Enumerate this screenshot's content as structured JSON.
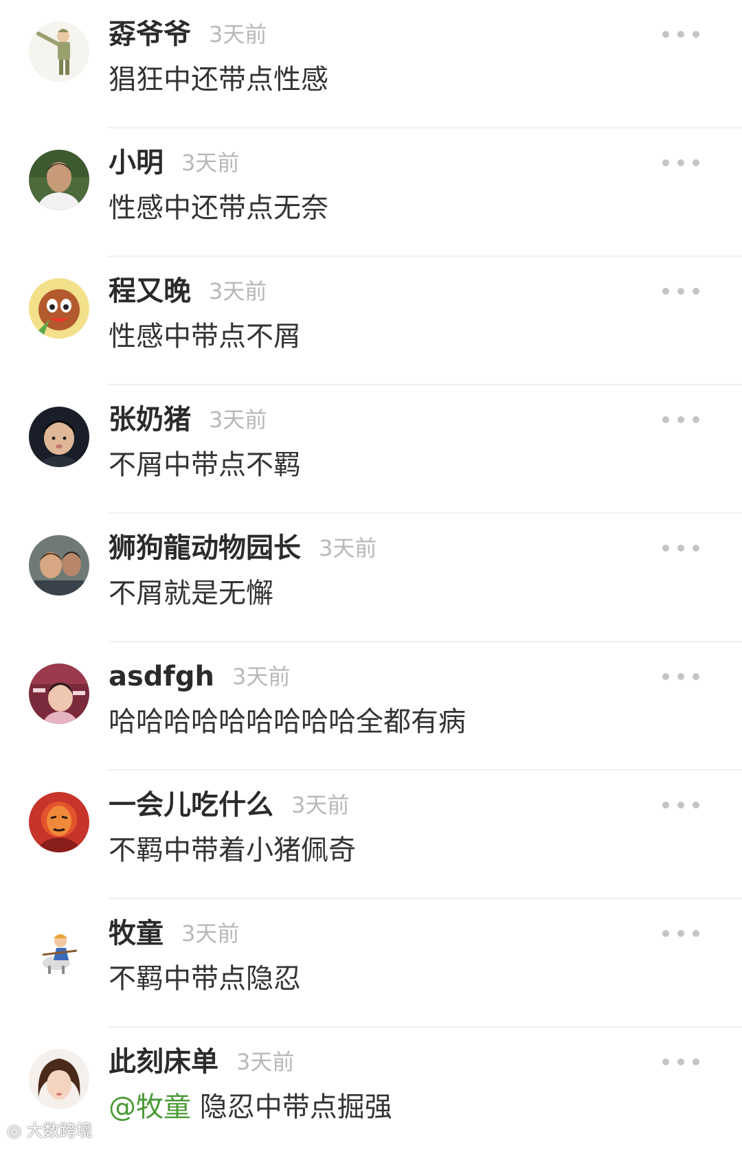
{
  "comments": [
    {
      "name": "孬爷爷",
      "time": "3天前",
      "text": "猖狂中还带点性感"
    },
    {
      "name": "小明",
      "time": "3天前",
      "text": "性感中还带点无奈"
    },
    {
      "name": "程又晚",
      "time": "3天前",
      "text": "性感中带点不屑"
    },
    {
      "name": "张奶猪",
      "time": "3天前",
      "text": "不屑中带点不羁"
    },
    {
      "name": "狮狗龍动物园长",
      "time": "3天前",
      "text": "不屑就是无懈"
    },
    {
      "name": "asdfgh",
      "time": "3天前",
      "text": "哈哈哈哈哈哈哈哈哈全都有病"
    },
    {
      "name": "一会儿吃什么",
      "time": "3天前",
      "text": "不羁中带着小猪佩奇"
    },
    {
      "name": "牧童",
      "time": "3天前",
      "text": "不羁中带点隐忍"
    },
    {
      "name": "此刻床单",
      "time": "3天前",
      "mention": "@牧童",
      "text": "隐忍中带点掘强"
    }
  ],
  "icons": {
    "more": "more-dots-icon"
  },
  "colors": {
    "name": "#2b2b2b",
    "time": "#b8b8b8",
    "text": "#333333",
    "mention": "#4a9a35",
    "divider": "#efefef"
  },
  "watermark": "大数跨境"
}
